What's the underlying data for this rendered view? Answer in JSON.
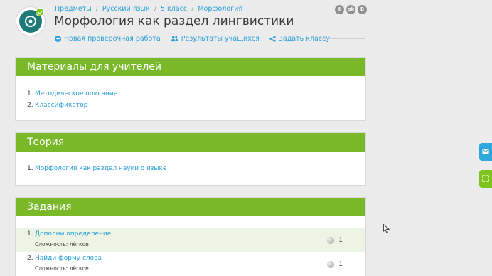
{
  "breadcrumb": [
    "Предметы",
    "Русский язык",
    "5 класс",
    "Морфология"
  ],
  "page_title": "Морфология как раздел лингвистики",
  "actions": {
    "new_test": "Новая проверочная работа",
    "results": "Результаты учащихся",
    "assign": "Задать классу"
  },
  "social": [
    "©",
    "ok",
    "B"
  ],
  "teacher_materials": {
    "heading": "Материалы для учителей",
    "items": [
      {
        "num": "1.",
        "label": "Методическое описание"
      },
      {
        "num": "2.",
        "label": "Классификатор"
      }
    ]
  },
  "theory": {
    "heading": "Теория",
    "items": [
      {
        "num": "1.",
        "label": "Морфология как раздел науки о языке"
      }
    ]
  },
  "tasks": {
    "heading": "Задания",
    "items": [
      {
        "num": "1.",
        "label": "Дополни определение",
        "difficulty": "Сложность: лёгкое",
        "points": "1"
      },
      {
        "num": "2.",
        "label": "Найди форму слова",
        "difficulty": "Сложность: лёгкое",
        "points": "1"
      }
    ]
  },
  "colors": {
    "accent_green": "#79b828",
    "link_blue": "#2a9fd6",
    "side_mail": "#2ea7db",
    "side_expand": "#7dc41f"
  }
}
